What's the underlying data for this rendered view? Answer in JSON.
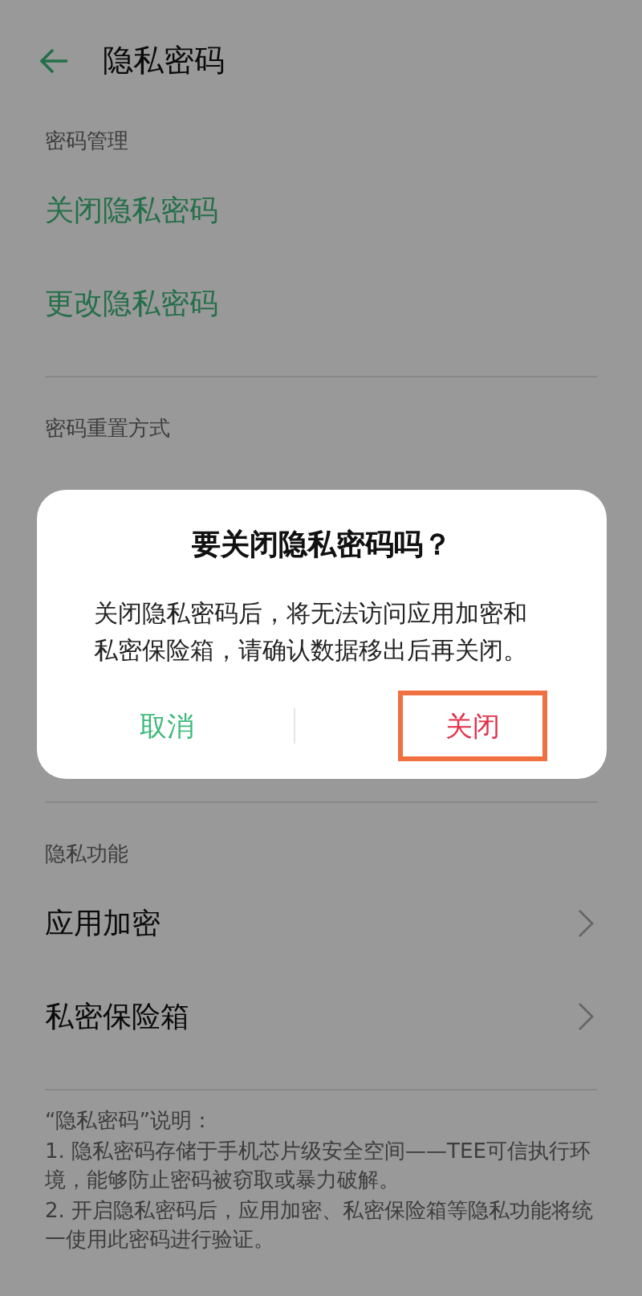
{
  "header": {
    "title": "隐私密码"
  },
  "sections": [
    {
      "title": "密码管理",
      "items": [
        {
          "label": "关闭隐私密码",
          "kind": "action"
        },
        {
          "label": "更改隐私密码",
          "kind": "action"
        }
      ]
    },
    {
      "title": "密码重置方式"
    },
    {
      "title": "隐私功能",
      "items": [
        {
          "label": "应用加密",
          "kind": "nav"
        },
        {
          "label": "私密保险箱",
          "kind": "nav"
        }
      ]
    }
  ],
  "notes": {
    "title": "“隐私密码”说明：",
    "paragraphs": [
      "1. 隐私密码存储于手机芯片级安全空间——TEE可信执行环境，能够防止密码被窃取或暴力破解。",
      "2. 开启隐私密码后，应用加密、私密保险箱等隐私功能将统一使用此密码进行验证。"
    ]
  },
  "dialog": {
    "title": "要关闭隐私密码吗？",
    "message": "关闭隐私密码后，将无法访问应用加密和私密保险箱，请确认数据移出后再关闭。",
    "buttons": [
      {
        "label": "取消",
        "kind": "cancel",
        "highlighted": false
      },
      {
        "label": "关闭",
        "kind": "confirm",
        "highlighted": true
      }
    ]
  }
}
